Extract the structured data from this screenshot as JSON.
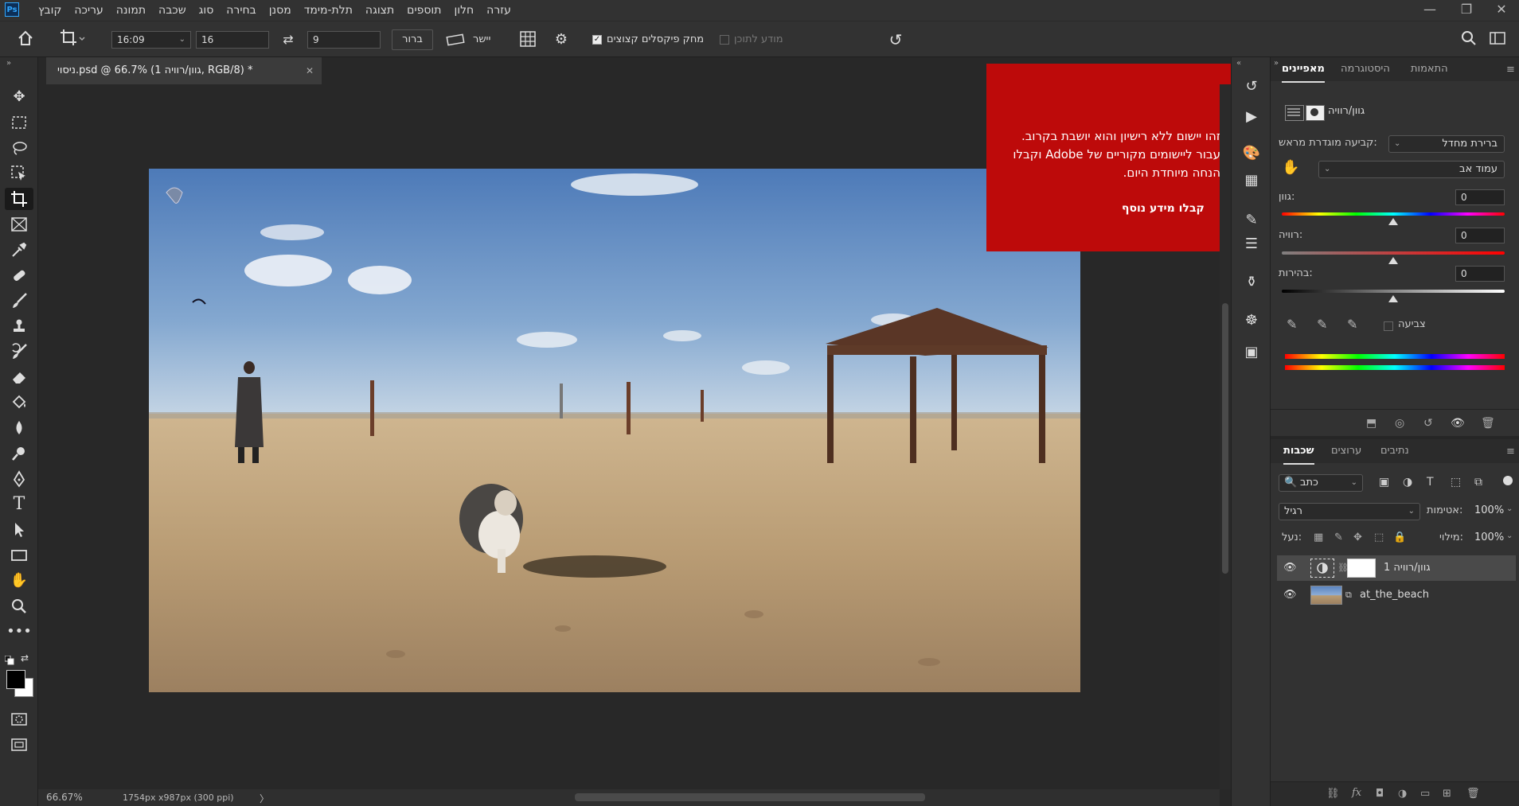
{
  "app": {
    "logo": "Ps"
  },
  "menu": [
    "קובץ",
    "עריכה",
    "תמונה",
    "שכבה",
    "סוג",
    "בחירה",
    "מסנן",
    "תלת-מימד",
    "תצוגה",
    "תוספים",
    "חלון",
    "עזרה"
  ],
  "window_controls": {
    "minimize": "—",
    "restore": "❐",
    "close": "✕"
  },
  "options": {
    "ratio": "16:09",
    "width": "16",
    "height": "9",
    "clear_label": "ברור",
    "straighten_label": "יישר",
    "delete_cropped_label": "מחק פיקסלים קצוצים",
    "content_aware_label": "מודע לתוכן"
  },
  "document_tab": {
    "title": "ניסוי.psd @ 66.7% (גוון/רוויה 1, RGB/8) *",
    "close": "✕"
  },
  "status": {
    "zoom": "66.67%",
    "doc_info": "1754px x987px (300 ppi)",
    "arrow": "〉"
  },
  "promo": {
    "message": "זהו יישום ללא רישיון והוא יושבת בקרוב. עבור ליישומים מקוריים של Adobe וקבלו הנחה מיוחדת היום.",
    "link": "קבלו מידע נוסף"
  },
  "properties_panel": {
    "tabs": [
      "מאפיינים",
      "היסטוגרמה",
      "התאמות"
    ],
    "active_tab": "מאפיינים",
    "adjustment_title": "גוון/רוויה",
    "preset_label": "קביעה מוגדרת מראש:",
    "preset_value": "ברירת מחדל",
    "channel_value": "עמוד אב",
    "hue_label": "גוון:",
    "hue_value": "0",
    "saturation_label": "רוויה:",
    "saturation_value": "0",
    "lightness_label": "בהירות:",
    "lightness_value": "0",
    "colorize_label": "צביעה"
  },
  "layers_panel": {
    "tabs": [
      "שכבות",
      "ערוצים",
      "נתיבים"
    ],
    "active_tab": "שכבות",
    "filter_kind": "כתב",
    "blend_mode": "רגיל",
    "opacity_label": "אטימות:",
    "opacity_value": "100%",
    "lock_label": "נעל:",
    "fill_label": "מילוי:",
    "fill_value": "100%",
    "layers": [
      {
        "name": "גוון/רוויה 1",
        "selected": true
      },
      {
        "name": "at_the_beach",
        "selected": false
      }
    ]
  },
  "colors": {
    "accent_red": "#bd0a0a",
    "panel_bg": "#323232",
    "canvas_bg": "#282828"
  }
}
